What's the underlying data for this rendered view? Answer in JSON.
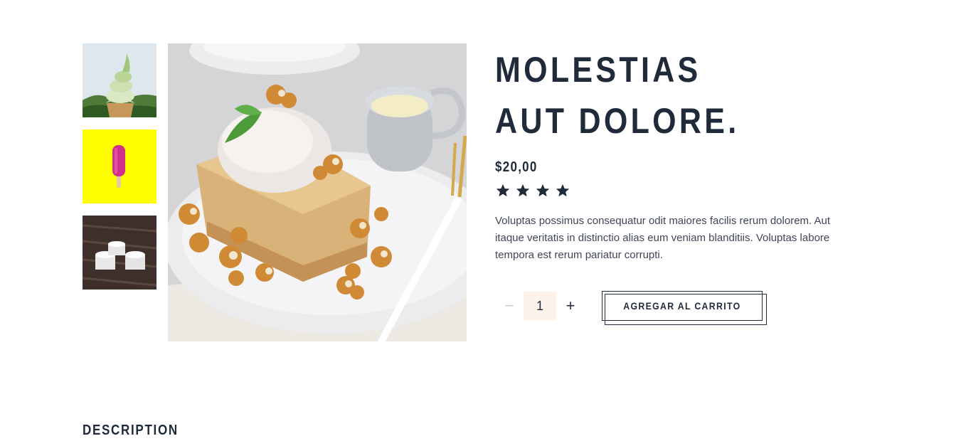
{
  "product": {
    "title": "MOLESTIAS AUT DOLORE.",
    "price": "$20,00",
    "rating_stars": 4,
    "description": "Voluptas possimus consequatur odit maiores facilis rerum dolorem. Aut itaque veritatis in distinctio alias eum veniam blanditiis. Voluptas labore tempora est rerum pariatur corrupti."
  },
  "gallery": {
    "thumbnails": [
      {
        "name": "soft-serve-ice-cream-thumbnail"
      },
      {
        "name": "pink-popsicle-thumbnail"
      },
      {
        "name": "ice-cream-cups-thumbnail"
      }
    ],
    "main_image": "bread-pudding-with-ice-cream-and-caramel-popcorn"
  },
  "cart": {
    "minus_label": "−",
    "quantity": "1",
    "plus_label": "+",
    "add_label": "AGREGAR AL CARRITO"
  },
  "sections": {
    "description_title": "DESCRIPTION"
  },
  "colors": {
    "heading": "#1f2a3b",
    "quantity_bg": "#fdf3ea",
    "popsicle_bg": "#ffff00"
  }
}
